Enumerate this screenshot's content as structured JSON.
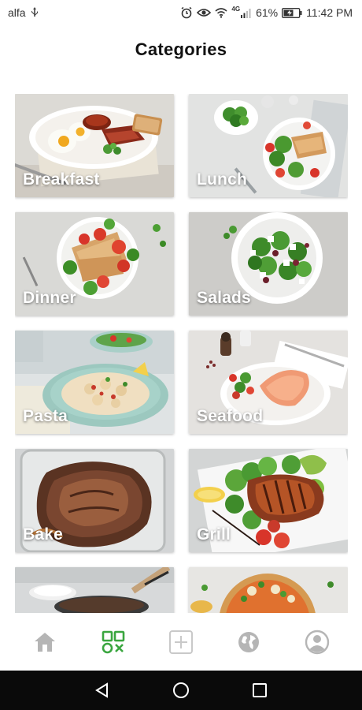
{
  "status_bar": {
    "carrier": "alfa",
    "network_type": "4G",
    "battery": "61%",
    "time": "11:42 PM"
  },
  "header": {
    "title": "Categories"
  },
  "categories": [
    {
      "label": "Breakfast"
    },
    {
      "label": "Lunch"
    },
    {
      "label": "Dinner"
    },
    {
      "label": "Salads"
    },
    {
      "label": "Pasta"
    },
    {
      "label": "Seafood"
    },
    {
      "label": "Bake"
    },
    {
      "label": "Grill"
    },
    {
      "label": ""
    },
    {
      "label": ""
    }
  ],
  "bottom_nav": {
    "items": [
      "home-icon",
      "categories-icon",
      "add-icon",
      "explore-globe-icon",
      "profile-icon"
    ],
    "active": "categories-icon",
    "active_color": "#3aa63f",
    "inactive_color": "#b5b5b5"
  },
  "system_nav": {
    "items": [
      "back-icon",
      "home-circle-icon",
      "recents-icon"
    ]
  }
}
